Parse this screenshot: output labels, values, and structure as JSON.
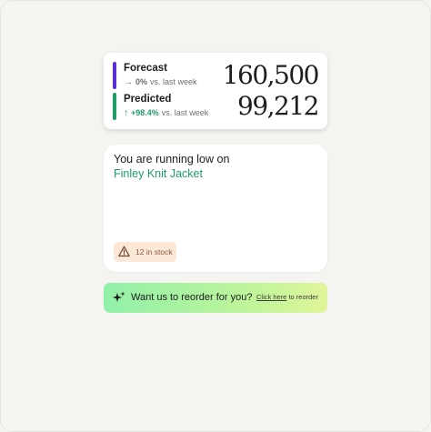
{
  "metrics": [
    {
      "label": "Forecast",
      "change_arrow": "→",
      "change_pct": "0%",
      "change_suffix": "vs. last week",
      "value": "160,500",
      "accent_color": "#5b2fd6",
      "change_color": "#6f6f6f"
    },
    {
      "label": "Predicted",
      "change_arrow": "↑",
      "change_pct": "+98.4%",
      "change_suffix": "vs. last week",
      "value": "99,212",
      "accent_color": "#1f9d67",
      "change_color": "#1f9d67"
    }
  ],
  "low_stock": {
    "title": "You are running low on",
    "product": "Finley Knit Jacket",
    "badge_icon": "warning-triangle-icon",
    "badge_text": "12 in stock",
    "product_color": "#1f9d67",
    "badge_bg": "#fbe8d6"
  },
  "reorder": {
    "icon": "sparkle-icon",
    "question": "Want us to reorder for you?",
    "link_text": "Click here",
    "link_suffix": "to reorder"
  }
}
